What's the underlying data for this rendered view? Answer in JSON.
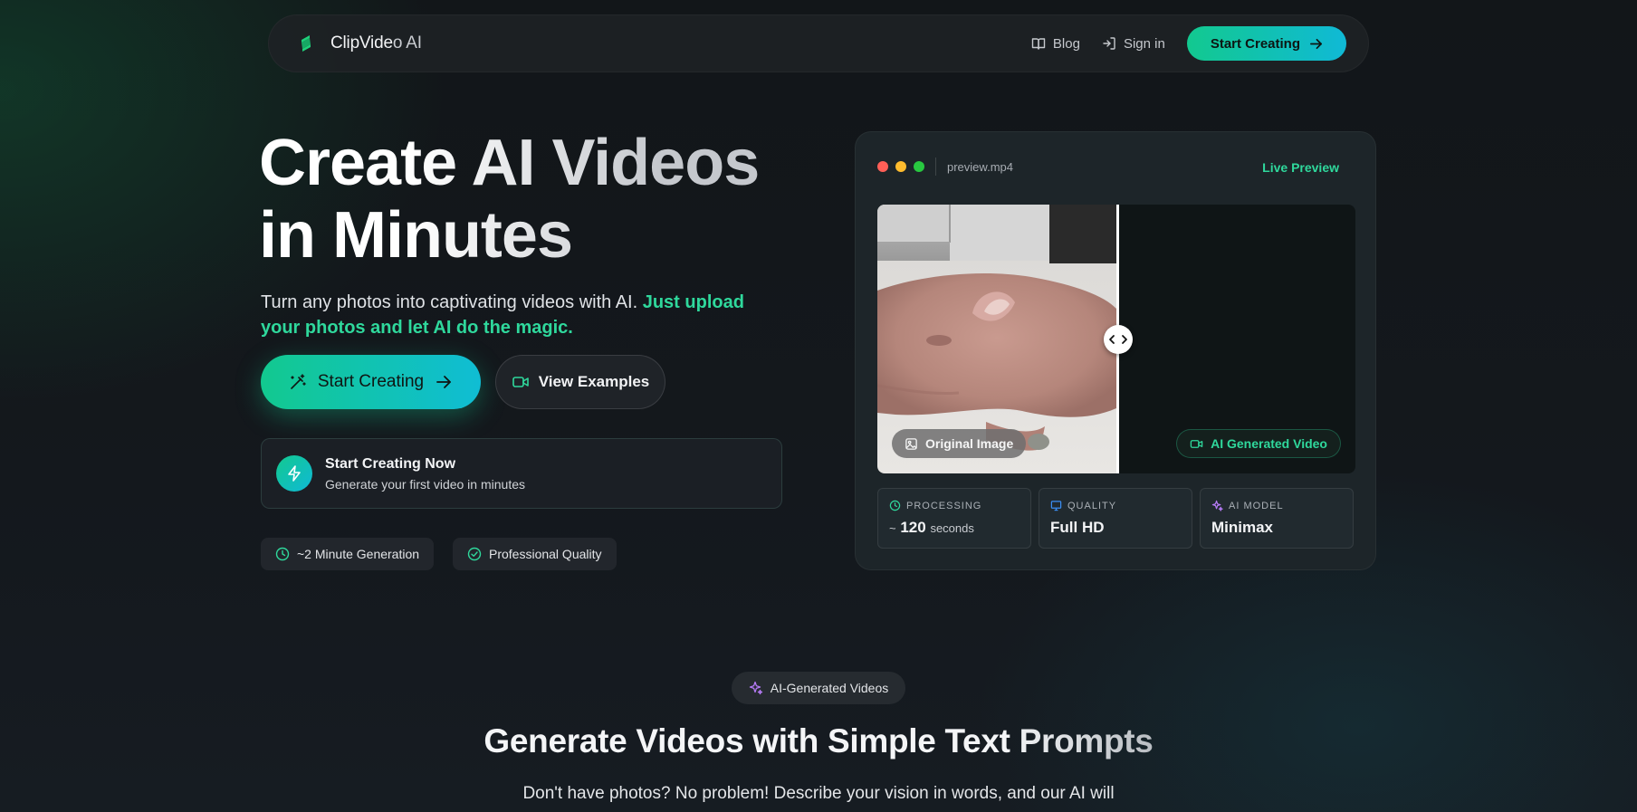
{
  "nav": {
    "logo_main": "ClipVide",
    "logo_rest": "o AI",
    "links": [
      {
        "label": "Blog",
        "icon": "book-icon"
      },
      {
        "label": "Sign in",
        "icon": "sign-in-icon"
      }
    ],
    "cta_label": "Start Creating"
  },
  "hero": {
    "title_line1": "Create AI Videos",
    "title_line2": "in Minutes",
    "subtitle_plain": "Turn any photos into captivating videos with AI. ",
    "subtitle_accent": "Just upload your photos and let AI do the magic.",
    "primary_button": "Start Creating",
    "secondary_button": "View Examples",
    "card_title": "Start Creating Now",
    "card_subtitle": "Generate your first video in minutes",
    "pills": [
      "~2 Minute Generation",
      "Professional Quality"
    ]
  },
  "preview": {
    "filename": "preview.mp4",
    "live_label": "Live Preview",
    "original_label": "Original Image",
    "ai_label": "AI Generated Video",
    "stats": [
      {
        "label": "PROCESSING",
        "prefix": "~",
        "value": "120",
        "suffix": "seconds"
      },
      {
        "label": "QUALITY",
        "value": "Full HD"
      },
      {
        "label": "AI MODEL",
        "value": "Minimax"
      }
    ]
  },
  "section": {
    "badge": "AI-Generated Videos",
    "title_plain": "Generate Videos with Simple Text ",
    "title_grad": "Prompts",
    "subtitle": "Don't have photos? No problem! Describe your vision in words, and our AI will"
  },
  "colors": {
    "accent_green": "#2fd89c",
    "gradient_start": "#12c98f",
    "gradient_end": "#10b9d6"
  }
}
